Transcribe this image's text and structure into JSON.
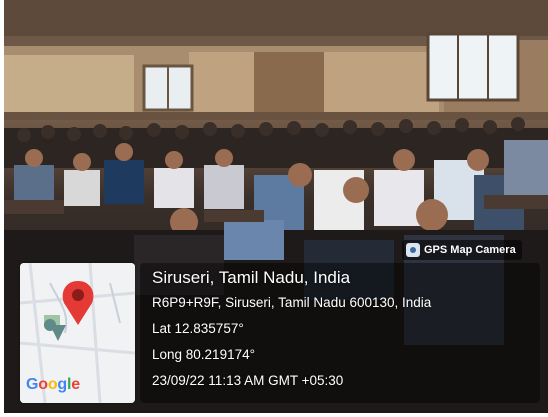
{
  "badge": {
    "label": "GPS Map Camera",
    "icon": "camera-icon"
  },
  "location": {
    "place": "Siruseri, Tamil Nadu, India",
    "address": "R6P9+R9F, Siruseri, Tamil Nadu 600130, India",
    "lat": "Lat 12.835757°",
    "long": "Long 80.219174°",
    "datetime": "23/09/22 11:13 AM GMT +05:30"
  },
  "map": {
    "logo": [
      "G",
      "o",
      "o",
      "g",
      "l",
      "e"
    ],
    "pin_color": "#e53935",
    "icon": "map-pin-icon"
  },
  "scene": {
    "description_icon": "audience-photo"
  }
}
